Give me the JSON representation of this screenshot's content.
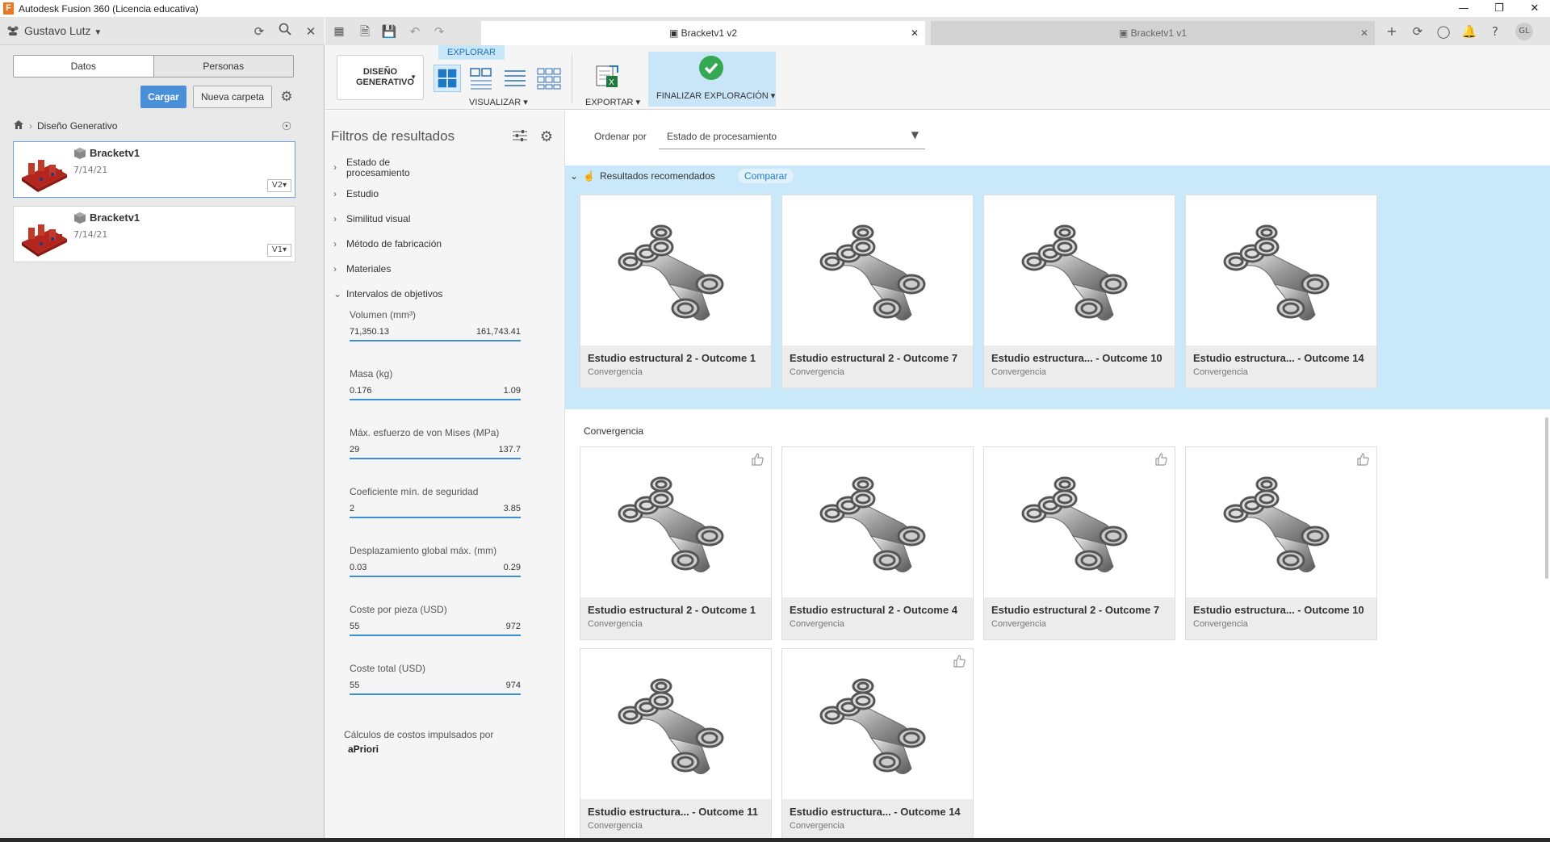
{
  "window": {
    "title": "Autodesk Fusion 360 (Licencia educativa)"
  },
  "data_panel": {
    "user": "Gustavo Lutz",
    "tabs": [
      "Datos",
      "Personas"
    ],
    "upload_label": "Cargar",
    "new_folder_label": "Nueva carpeta",
    "breadcrumb": "Diseño Generativo",
    "files": [
      {
        "name": "Bracketv1",
        "date": "7/14/21",
        "version": "V2▾"
      },
      {
        "name": "Bracketv1",
        "date": "7/14/21",
        "version": "V1▾"
      }
    ]
  },
  "doc_tabs": [
    {
      "label": "Bracketv1 v2",
      "active": true
    },
    {
      "label": "Bracketv1 v1",
      "active": false
    }
  ],
  "ribbon": {
    "generative_design": "DISEÑO GENERATIVO",
    "explore_tab": "EXPLORAR",
    "visualize": "VISUALIZAR ▾",
    "export": "EXPORTAR ▾",
    "finish": "FINALIZAR EXPLORACIÓN ▾"
  },
  "filters": {
    "title": "Filtros de resultados",
    "categories": [
      "Estado de procesamiento",
      "Estudio",
      "Similitud visual",
      "Método de fabricación",
      "Materiales",
      "Intervalos de objetivos"
    ],
    "ranges": [
      {
        "label": "Volumen (mm³)",
        "min": "71,350.13",
        "max": "161,743.41"
      },
      {
        "label": "Masa (kg)",
        "min": "0.176",
        "max": "1.09"
      },
      {
        "label": "Máx. esfuerzo de von Mises (MPa)",
        "min": "29",
        "max": "137.7"
      },
      {
        "label": "Coeficiente mín. de seguridad",
        "min": "2",
        "max": "3.85"
      },
      {
        "label": "Desplazamiento global máx. (mm)",
        "min": "0.03",
        "max": "0.29"
      },
      {
        "label": "Coste por pieza (USD)",
        "min": "55",
        "max": "972"
      },
      {
        "label": "Coste total (USD)",
        "min": "55",
        "max": "974"
      }
    ],
    "cost_note": "Cálculos de costos impulsados por",
    "cost_brand": "aPriori"
  },
  "sort": {
    "label": "Ordenar por",
    "value": "Estado de procesamiento"
  },
  "recommended": {
    "title": "Resultados recomendados",
    "compare": "Comparar",
    "cards": [
      {
        "title": "Estudio estructural 2 - Outcome 1",
        "sub": "Convergencia"
      },
      {
        "title": "Estudio estructural 2 - Outcome 7",
        "sub": "Convergencia"
      },
      {
        "title": "Estudio estructura... - Outcome 10",
        "sub": "Convergencia"
      },
      {
        "title": "Estudio estructura... - Outcome 14",
        "sub": "Convergencia"
      }
    ]
  },
  "convergence": {
    "title": "Convergencia",
    "cards": [
      {
        "title": "Estudio estructural 2 - Outcome 1",
        "sub": "Convergencia"
      },
      {
        "title": "Estudio estructural 2 - Outcome 4",
        "sub": "Convergencia"
      },
      {
        "title": "Estudio estructural 2 - Outcome 7",
        "sub": "Convergencia"
      },
      {
        "title": "Estudio estructura... - Outcome 10",
        "sub": "Convergencia"
      },
      {
        "title": "Estudio estructura... - Outcome 11",
        "sub": "Convergencia"
      },
      {
        "title": "Estudio estructura... - Outcome 14",
        "sub": "Convergencia"
      }
    ]
  },
  "user_initials": "GL"
}
